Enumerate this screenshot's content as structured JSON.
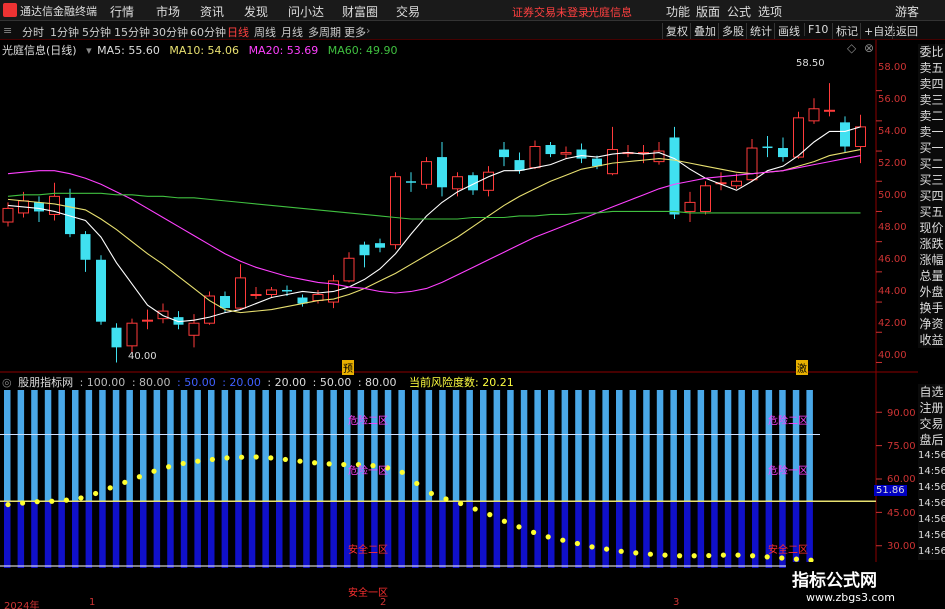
{
  "menubar": {
    "app_title": "通达信金融终端",
    "items": [
      "行情",
      "市场",
      "资讯",
      "发现",
      "问小达",
      "财富圈",
      "交易"
    ],
    "warning": "证券交易未登录",
    "stock_name": "光庭信息",
    "right_items": [
      "功能",
      "版面",
      "公式",
      "选项"
    ],
    "user": "游客",
    "logo_icon": "r-logo-icon"
  },
  "toolbar": {
    "periods": [
      "分时",
      "1分钟",
      "5分钟",
      "15分钟",
      "30分钟",
      "60分钟",
      "日线",
      "周线",
      "月线",
      "多周期",
      "更多"
    ],
    "active_period": "日线",
    "right_buttons": [
      "复权",
      "叠加",
      "多股",
      "统计",
      "画线",
      "F10",
      "标记",
      "+自选",
      "返回"
    ]
  },
  "info": {
    "title": "光庭信息(日线)",
    "ma5": "MA5: 55.60",
    "ma10": "MA10: 54.06",
    "ma20": "MA20: 53.69",
    "ma60": "MA60: 49.90"
  },
  "price_axis": [
    "58.00",
    "56.00",
    "54.00",
    "52.00",
    "50.00",
    "48.00",
    "46.00",
    "44.00",
    "42.00",
    "40.00"
  ],
  "annotations": {
    "high": "58.50",
    "low": "40.00",
    "yu": "预",
    "ji": "激"
  },
  "sidebar": {
    "top": [
      "委比",
      "卖五",
      "卖四",
      "卖三",
      "卖二",
      "卖一",
      "买一",
      "买二",
      "买三",
      "买四",
      "买五",
      "现价",
      "涨跌",
      "涨幅",
      "总量",
      "外盘",
      "换手",
      "净资",
      "收益"
    ],
    "bottom": [
      "自选",
      "注册",
      "交易",
      "盘后",
      "14:56",
      "14:56",
      "14:56",
      "14:56",
      "14:56",
      "14:56",
      "14:56"
    ]
  },
  "indicator": {
    "name": "股朋指标网",
    "values": [
      ": 100.00",
      ": 80.00",
      ": 50.00",
      ": 20.00",
      ": 20.00",
      ": 50.00",
      ": 80.00"
    ],
    "risk_label": "当前风险度数: 20.21",
    "axis": [
      "90.00",
      "75.00",
      "60.00",
      "45.00",
      "30.00"
    ],
    "current": "51.86",
    "zones": {
      "d2": "危险二区",
      "d1": "危险一区",
      "s2": "安全二区",
      "s1": "安全一区"
    }
  },
  "date_axis": [
    "2024年",
    "1",
    "2",
    "3"
  ],
  "watermark": {
    "line1": "指标公式网",
    "line2": "www.zbgs3.com"
  },
  "chart_data": {
    "type": "candlestick",
    "ylim": [
      39.5,
      59.5
    ],
    "candles": [
      {
        "o": 49.3,
        "c": 50.2,
        "h": 50.6,
        "l": 49.0
      },
      {
        "o": 49.9,
        "c": 50.7,
        "h": 51.3,
        "l": 49.6
      },
      {
        "o": 50.6,
        "c": 50.0,
        "h": 51.0,
        "l": 49.3
      },
      {
        "o": 49.8,
        "c": 51.0,
        "h": 51.9,
        "l": 49.4
      },
      {
        "o": 50.9,
        "c": 48.5,
        "h": 51.5,
        "l": 48.3
      },
      {
        "o": 48.5,
        "c": 46.8,
        "h": 48.7,
        "l": 46.0
      },
      {
        "o": 46.8,
        "c": 42.7,
        "h": 47.1,
        "l": 42.5
      },
      {
        "o": 42.3,
        "c": 41.0,
        "h": 42.6,
        "l": 40.0
      },
      {
        "o": 41.1,
        "c": 42.6,
        "h": 42.9,
        "l": 40.6
      },
      {
        "o": 42.8,
        "c": 42.8,
        "h": 43.5,
        "l": 42.2
      },
      {
        "o": 42.9,
        "c": 43.4,
        "h": 43.9,
        "l": 42.6
      },
      {
        "o": 43.0,
        "c": 42.5,
        "h": 43.4,
        "l": 42.2
      },
      {
        "o": 41.8,
        "c": 42.6,
        "h": 43.2,
        "l": 41.0
      },
      {
        "o": 42.6,
        "c": 44.4,
        "h": 44.7,
        "l": 42.5
      },
      {
        "o": 44.4,
        "c": 43.6,
        "h": 44.7,
        "l": 43.3
      },
      {
        "o": 43.6,
        "c": 45.6,
        "h": 46.5,
        "l": 43.5
      },
      {
        "o": 44.5,
        "c": 44.5,
        "h": 45.0,
        "l": 44.2
      },
      {
        "o": 44.5,
        "c": 44.8,
        "h": 45.0,
        "l": 44.3
      },
      {
        "o": 44.8,
        "c": 44.7,
        "h": 45.1,
        "l": 44.4
      },
      {
        "o": 44.3,
        "c": 43.9,
        "h": 44.5,
        "l": 43.7
      },
      {
        "o": 44.1,
        "c": 44.5,
        "h": 44.8,
        "l": 43.9
      },
      {
        "o": 44.0,
        "c": 45.4,
        "h": 45.8,
        "l": 43.6
      },
      {
        "o": 45.4,
        "c": 46.9,
        "h": 47.3,
        "l": 45.3
      },
      {
        "o": 47.8,
        "c": 47.1,
        "h": 48.0,
        "l": 46.3
      },
      {
        "o": 47.9,
        "c": 47.6,
        "h": 48.2,
        "l": 47.3
      },
      {
        "o": 47.8,
        "c": 52.3,
        "h": 52.6,
        "l": 47.5
      },
      {
        "o": 52.0,
        "c": 51.9,
        "h": 52.6,
        "l": 51.3
      },
      {
        "o": 51.8,
        "c": 53.3,
        "h": 53.6,
        "l": 51.5
      },
      {
        "o": 53.6,
        "c": 51.6,
        "h": 54.6,
        "l": 51.0
      },
      {
        "o": 51.5,
        "c": 52.3,
        "h": 52.6,
        "l": 51.0
      },
      {
        "o": 52.4,
        "c": 51.4,
        "h": 52.6,
        "l": 51.1
      },
      {
        "o": 51.4,
        "c": 52.6,
        "h": 53.0,
        "l": 51.0
      },
      {
        "o": 54.1,
        "c": 53.6,
        "h": 54.6,
        "l": 53.0
      },
      {
        "o": 53.4,
        "c": 52.7,
        "h": 53.9,
        "l": 52.5
      },
      {
        "o": 52.9,
        "c": 54.3,
        "h": 54.7,
        "l": 52.8
      },
      {
        "o": 54.4,
        "c": 53.8,
        "h": 54.6,
        "l": 53.6
      },
      {
        "o": 53.8,
        "c": 53.9,
        "h": 54.3,
        "l": 53.5
      },
      {
        "o": 54.1,
        "c": 53.5,
        "h": 54.5,
        "l": 53.2
      },
      {
        "o": 53.5,
        "c": 53.0,
        "h": 53.7,
        "l": 52.8
      },
      {
        "o": 52.5,
        "c": 54.1,
        "h": 55.6,
        "l": 52.4
      },
      {
        "o": 53.9,
        "c": 53.9,
        "h": 54.4,
        "l": 53.6
      },
      {
        "o": 53.9,
        "c": 53.9,
        "h": 54.4,
        "l": 53.2
      },
      {
        "o": 53.3,
        "c": 54.0,
        "h": 54.6,
        "l": 53.1
      },
      {
        "o": 54.9,
        "c": 49.8,
        "h": 55.6,
        "l": 49.5
      },
      {
        "o": 50.0,
        "c": 50.6,
        "h": 51.3,
        "l": 49.3
      },
      {
        "o": 50.0,
        "c": 51.7,
        "h": 52.0,
        "l": 49.8
      },
      {
        "o": 51.9,
        "c": 51.9,
        "h": 52.6,
        "l": 51.4
      },
      {
        "o": 51.7,
        "c": 52.0,
        "h": 52.5,
        "l": 51.5
      },
      {
        "o": 52.1,
        "c": 54.2,
        "h": 54.8,
        "l": 52.0
      },
      {
        "o": 54.3,
        "c": 54.2,
        "h": 55.0,
        "l": 53.6
      },
      {
        "o": 54.2,
        "c": 53.6,
        "h": 54.9,
        "l": 53.3
      },
      {
        "o": 53.6,
        "c": 56.2,
        "h": 56.6,
        "l": 53.5
      },
      {
        "o": 56.0,
        "c": 56.8,
        "h": 57.5,
        "l": 55.8
      },
      {
        "o": 56.7,
        "c": 56.7,
        "h": 58.5,
        "l": 56.3
      },
      {
        "o": 55.9,
        "c": 54.3,
        "h": 56.3,
        "l": 53.9
      },
      {
        "o": 54.3,
        "c": 55.6,
        "h": 56.4,
        "l": 53.2
      }
    ],
    "ma_lines": {
      "ma5": {
        "color": "#ffffff",
        "values": [
          50.4,
          50.3,
          50.2,
          50.0,
          49.7,
          49.4,
          48.3,
          46.6,
          45.2,
          43.8,
          43.1,
          42.7,
          42.8,
          43.0,
          43.3,
          43.5,
          43.9,
          44.3,
          44.5,
          44.7,
          44.6,
          44.7,
          45.0,
          45.5,
          46.2,
          47.2,
          48.5,
          49.7,
          50.6,
          51.3,
          51.8,
          52.3,
          52.7,
          52.7,
          52.9,
          53.1,
          53.5,
          53.7,
          53.6,
          53.8,
          53.9,
          53.8,
          53.9,
          53.5,
          52.8,
          52.2,
          51.8,
          51.4,
          52.0,
          52.7,
          53.0,
          53.7,
          54.6,
          55.3,
          55.3,
          55.6
        ]
      },
      "ma10": {
        "color": "#e8e070",
        "values": [
          50.8,
          50.7,
          50.6,
          50.5,
          50.3,
          50.1,
          49.5,
          48.8,
          48.0,
          47.2,
          46.5,
          45.7,
          44.9,
          44.1,
          43.5,
          43.3,
          43.4,
          43.5,
          43.7,
          43.9,
          44.1,
          44.2,
          44.5,
          44.9,
          45.4,
          45.9,
          46.5,
          47.1,
          47.7,
          48.3,
          49.0,
          49.7,
          50.4,
          51.0,
          51.5,
          52.0,
          52.4,
          52.8,
          53.0,
          53.2,
          53.3,
          53.4,
          53.5,
          53.4,
          53.2,
          53.0,
          52.8,
          52.6,
          52.5,
          52.6,
          52.7,
          53.0,
          53.3,
          53.7,
          53.9,
          54.1
        ]
      },
      "ma20": {
        "color": "#ff40ff",
        "values": [
          52.5,
          52.6,
          52.7,
          52.7,
          52.5,
          52.2,
          51.8,
          51.3,
          50.8,
          50.2,
          49.6,
          49.0,
          48.4,
          47.8,
          47.2,
          46.7,
          46.3,
          46.0,
          45.7,
          45.5,
          45.3,
          45.2,
          45.0,
          44.9,
          44.7,
          44.6,
          44.7,
          44.9,
          45.3,
          45.8,
          46.3,
          46.8,
          47.3,
          47.8,
          48.3,
          48.7,
          49.1,
          49.5,
          49.9,
          50.3,
          50.7,
          51.1,
          51.5,
          51.8,
          52.0,
          52.2,
          52.3,
          52.4,
          52.5,
          52.6,
          52.7,
          52.9,
          53.1,
          53.3,
          53.5,
          53.7
        ]
      },
      "ma60": {
        "color": "#40c040",
        "values": [
          51.0,
          51.1,
          51.1,
          51.2,
          51.2,
          51.2,
          51.2,
          51.1,
          51.1,
          51.0,
          51.0,
          50.9,
          50.9,
          50.8,
          50.7,
          50.6,
          50.5,
          50.4,
          50.3,
          50.2,
          50.1,
          50.0,
          49.9,
          49.8,
          49.7,
          49.6,
          49.5,
          49.5,
          49.5,
          49.5,
          49.6,
          49.6,
          49.6,
          49.7,
          49.7,
          49.8,
          49.8,
          49.9,
          49.9,
          50.0,
          50.0,
          50.0,
          50.0,
          50.0,
          49.9,
          49.9,
          49.9,
          49.9,
          49.9,
          49.9,
          49.9,
          49.9,
          49.9,
          49.9,
          49.9,
          49.9
        ]
      }
    },
    "indicator_ylim": [
      20,
      100
    ],
    "indicator_bars_top": 100,
    "indicator_bars_mid": 50,
    "indicator_line_80": 80,
    "indicator_line_20": 20,
    "dots": [
      48.5,
      49.2,
      49.8,
      50.0,
      50.5,
      51.5,
      53.5,
      56.0,
      58.5,
      61.0,
      63.5,
      65.5,
      67.0,
      68.0,
      68.8,
      69.5,
      69.8,
      69.9,
      69.5,
      68.8,
      68.0,
      67.3,
      66.8,
      66.5,
      66.5,
      66.0,
      65.0,
      63.0,
      58.0,
      53.5,
      51.0,
      49.0,
      46.5,
      44.0,
      41.0,
      38.5,
      36.0,
      34.0,
      32.5,
      31.0,
      29.5,
      28.5,
      27.5,
      26.8,
      26.2,
      25.8,
      25.5,
      25.5,
      25.6,
      25.8,
      25.8,
      25.5,
      25.0,
      24.5,
      24.0,
      23.5
    ]
  }
}
